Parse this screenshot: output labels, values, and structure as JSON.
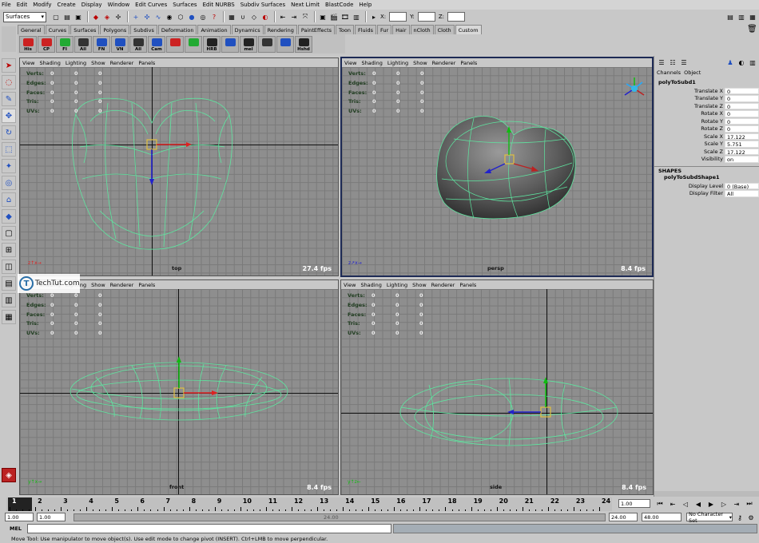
{
  "menu": [
    "File",
    "Edit",
    "Modify",
    "Create",
    "Display",
    "Window",
    "Edit Curves",
    "Surfaces",
    "Edit NURBS",
    "Subdiv Surfaces",
    "Next Limit",
    "BlastCode",
    "Help"
  ],
  "status": {
    "mode_select": "Surfaces",
    "field_x_label": "X:",
    "field_y_label": "Y:",
    "field_z_label": "Z:"
  },
  "shelf_tabs": [
    "General",
    "Curves",
    "Surfaces",
    "Polygons",
    "Subdivs",
    "Deformation",
    "Animation",
    "Dynamics",
    "Rendering",
    "PaintEffects",
    "Toon",
    "Fluids",
    "Fur",
    "Hair",
    "nCloth",
    "Cloth",
    "Custom"
  ],
  "shelf_active_tab": "Custom",
  "shelf_buttons": [
    "His",
    "CP",
    "FI",
    "All",
    "FN",
    "VN",
    "All",
    "Cam",
    "",
    "",
    "HRB",
    "",
    "mel",
    "",
    "",
    "Hshd"
  ],
  "viewport_menu": [
    "View",
    "Shading",
    "Lighting",
    "Show",
    "Renderer",
    "Panels"
  ],
  "hud": {
    "labels": [
      "Verts:",
      "Edges:",
      "Faces:",
      "Tris:",
      "UVs:"
    ],
    "values": [
      "0",
      "0",
      "0"
    ]
  },
  "viewports": [
    {
      "name": "top",
      "fps": "27.4 fps"
    },
    {
      "name": "persp",
      "fps": "8.4 fps"
    },
    {
      "name": "front",
      "fps": "8.4 fps"
    },
    {
      "name": "side",
      "fps": "8.4 fps"
    }
  ],
  "channel_box": {
    "tabs": [
      "Channels",
      "Object"
    ],
    "object_name": "polyToSubd1",
    "attributes": [
      {
        "label": "Translate X",
        "value": "0"
      },
      {
        "label": "Translate Y",
        "value": "0"
      },
      {
        "label": "Translate Z",
        "value": "0"
      },
      {
        "label": "Rotate X",
        "value": "0"
      },
      {
        "label": "Rotate Y",
        "value": "0"
      },
      {
        "label": "Rotate Z",
        "value": "0"
      },
      {
        "label": "Scale X",
        "value": "17.122"
      },
      {
        "label": "Scale Y",
        "value": "5.751"
      },
      {
        "label": "Scale Z",
        "value": "17.122"
      },
      {
        "label": "Visibility",
        "value": "on"
      }
    ],
    "shapes_header": "SHAPES",
    "shape_name": "polyToSubdShape1",
    "shape_attributes": [
      {
        "label": "Display Level",
        "value": "0 (Base)"
      },
      {
        "label": "Display Filter",
        "value": "All"
      }
    ]
  },
  "timeline": {
    "ticks": [
      "1",
      "2",
      "3",
      "4",
      "5",
      "6",
      "7",
      "8",
      "9",
      "10",
      "11",
      "12",
      "13",
      "14",
      "15",
      "16",
      "17",
      "18",
      "19",
      "20",
      "21",
      "22",
      "23",
      "24"
    ],
    "current_frame": "1.00"
  },
  "range": {
    "start": "1.00",
    "playback_start": "1.00",
    "range_label": "24.00",
    "playback_end": "24.00",
    "end": "48.00",
    "character_set": "No Character Set"
  },
  "cmd": {
    "label": "MEL"
  },
  "help_line": "Move Tool: Use manipulator to move object(s). Use edit mode to change pivot (INSERT). Ctrl+LMB to move perpendicular.",
  "watermark": "TechTut.com",
  "colors": {
    "wire": "#5ee6a0",
    "viewport_bg": "#8e8e8e",
    "active_border": "#1d2a55"
  }
}
